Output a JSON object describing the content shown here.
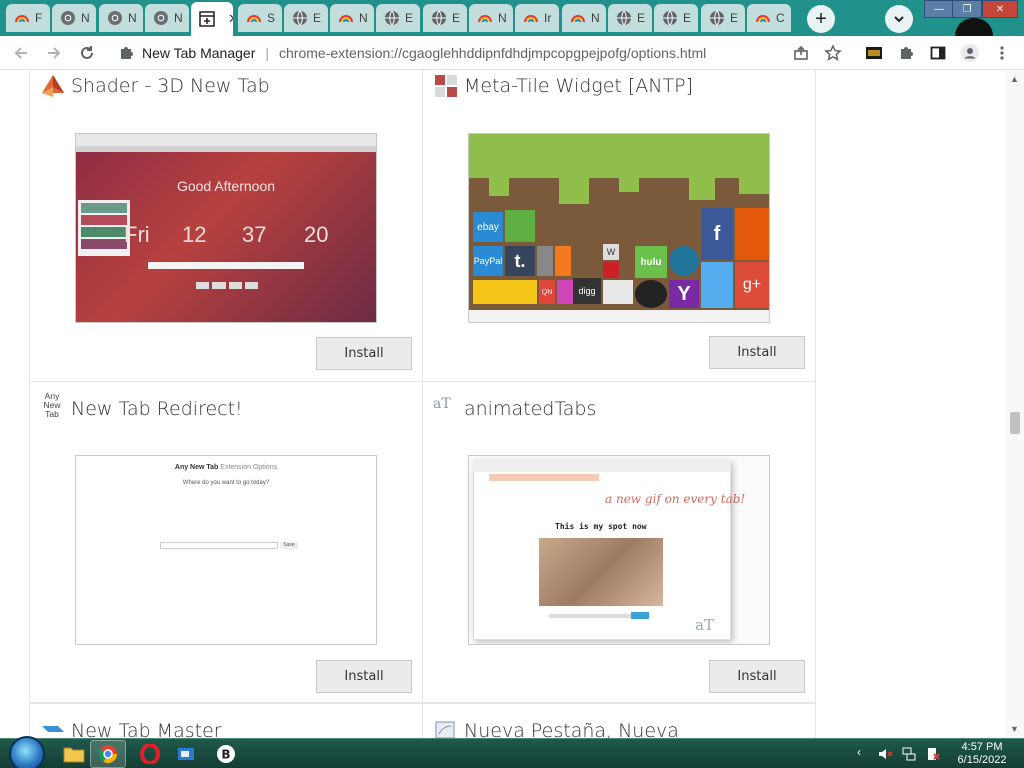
{
  "browser": {
    "tabs": [
      {
        "label": "F",
        "favicon": "rainbow-favicon"
      },
      {
        "label": "N",
        "favicon": "chrome-favicon"
      },
      {
        "label": "N",
        "favicon": "chrome-favicon"
      },
      {
        "label": "N",
        "favicon": "chrome-favicon"
      },
      {
        "label": "",
        "favicon": "extension-manager-favicon",
        "active": true
      },
      {
        "label": "S",
        "favicon": "rainbow-favicon"
      },
      {
        "label": "E",
        "favicon": "globe-favicon"
      },
      {
        "label": "N",
        "favicon": "rainbow-favicon"
      },
      {
        "label": "E",
        "favicon": "globe-favicon"
      },
      {
        "label": "E",
        "favicon": "globe-favicon"
      },
      {
        "label": "N",
        "favicon": "rainbow-favicon"
      },
      {
        "label": "Ir",
        "favicon": "rainbow-favicon"
      },
      {
        "label": "N",
        "favicon": "rainbow-favicon"
      },
      {
        "label": "E",
        "favicon": "globe-favicon"
      },
      {
        "label": "E",
        "favicon": "globe-favicon"
      },
      {
        "label": "E",
        "favicon": "globe-favicon"
      },
      {
        "label": "C",
        "favicon": "rainbow-favicon"
      }
    ],
    "new_tab_symbol": "+",
    "tab_close_symbol": "✕",
    "window_buttons": {
      "minimize": "—",
      "maximize": "❐",
      "close": "✕"
    }
  },
  "toolbar": {
    "site_name": "New Tab Manager",
    "separator": "|",
    "url": "chrome-extension://cgaoglehhddipnfdhdjmpcopgpejpofg/options.html"
  },
  "cards": [
    {
      "title": "Shader - 3D New Tab",
      "icon": "shader-icon",
      "install_label": "Install",
      "preview": {
        "greeting": "Good Afternoon",
        "day": "Fri",
        "hours": "12",
        "minutes": "37",
        "seconds": "20"
      }
    },
    {
      "title": "Meta-Tile Widget [ANTP]",
      "icon": "meta-tile-icon",
      "install_label": "Install",
      "preview": {
        "tiles": [
          "ebay",
          "PayPal",
          "t.",
          "digg",
          "hulu",
          "f",
          "g+",
          "Y",
          "W",
          "QN"
        ]
      }
    },
    {
      "title": "New Tab Redirect!",
      "icon_text": [
        "Any",
        "New",
        "Tab"
      ],
      "install_label": "Install",
      "preview": {
        "heading_bold": "Any New Tab",
        "heading_rest": "Extension Options",
        "question": "Where do you want to go today?",
        "save_label": "Save"
      }
    },
    {
      "title": "animatedTabs",
      "icon_text": "aT",
      "install_label": "Install",
      "preview": {
        "tagline": "a new gif on every tab!",
        "spot_text": "This is my spot now",
        "watermark": "aT"
      }
    },
    {
      "title": "New Tab Master",
      "icon": "new-tab-master-icon"
    },
    {
      "title": "Nueva Pestaña, Nueva",
      "icon": "nueva-pestana-icon"
    }
  ],
  "taskbar": {
    "time": "4:57 PM",
    "date": "6/15/2022",
    "apps": [
      "file-explorer-icon",
      "chrome-icon",
      "opera-icon",
      "app-icon",
      "bitwarden-icon"
    ]
  },
  "colors": {
    "tabstrip": "#21918b",
    "tab_inactive": "#c2dedc",
    "taskbar": "#1f5a4a"
  }
}
